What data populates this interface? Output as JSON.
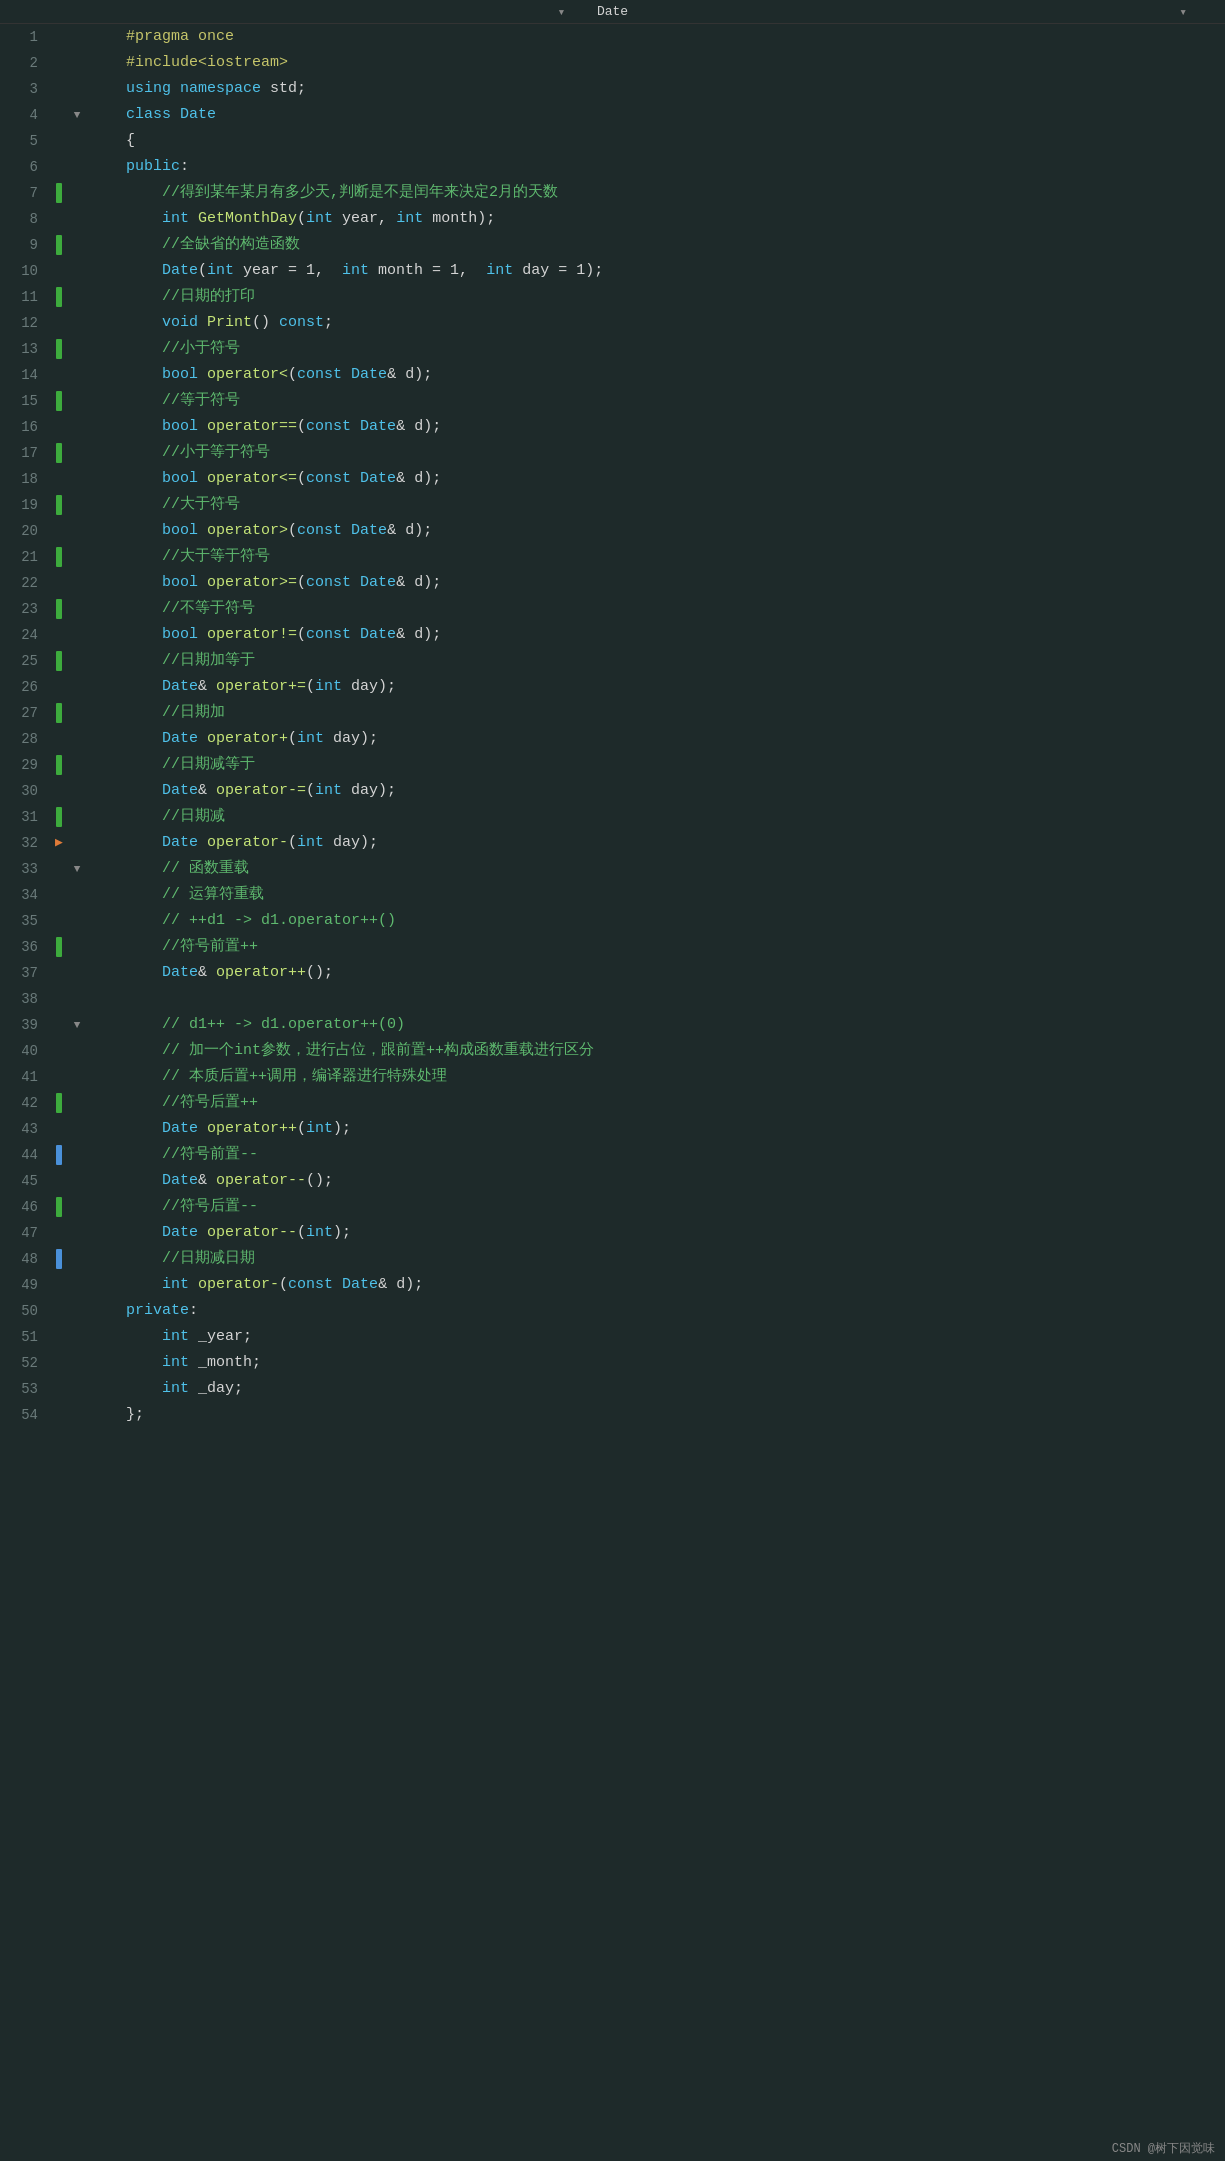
{
  "title": "Date",
  "footer": "CSDN @树下因觉味",
  "lines": [
    {
      "num": 1,
      "gutter": "",
      "fold": "",
      "tokens": [
        {
          "t": "pp",
          "v": "    #pragma once"
        }
      ]
    },
    {
      "num": 2,
      "gutter": "",
      "fold": "",
      "tokens": [
        {
          "t": "pp",
          "v": "    #include<iostream>"
        }
      ]
    },
    {
      "num": 3,
      "gutter": "",
      "fold": "",
      "tokens": [
        {
          "t": "normal",
          "v": "    "
        },
        {
          "t": "kw",
          "v": "using"
        },
        {
          "t": "normal",
          "v": " "
        },
        {
          "t": "kw",
          "v": "namespace"
        },
        {
          "t": "normal",
          "v": " std;"
        }
      ]
    },
    {
      "num": 4,
      "gutter": "",
      "fold": "▼",
      "tokens": [
        {
          "t": "kw",
          "v": "    class"
        },
        {
          "t": "normal",
          "v": " "
        },
        {
          "t": "type",
          "v": "Date"
        }
      ]
    },
    {
      "num": 5,
      "gutter": "",
      "fold": "",
      "tokens": [
        {
          "t": "normal",
          "v": "    {"
        }
      ]
    },
    {
      "num": 6,
      "gutter": "",
      "fold": "",
      "tokens": [
        {
          "t": "kw",
          "v": "    public"
        },
        {
          "t": "normal",
          "v": ":"
        }
      ]
    },
    {
      "num": 7,
      "gutter": "dot",
      "fold": "",
      "tokens": [
        {
          "t": "cm",
          "v": "        //得到某年某月有多少天,判断是不是闰年来决定2月的天数"
        }
      ]
    },
    {
      "num": 8,
      "gutter": "",
      "fold": "",
      "tokens": [
        {
          "t": "normal",
          "v": "        "
        },
        {
          "t": "kw",
          "v": "int"
        },
        {
          "t": "normal",
          "v": " "
        },
        {
          "t": "fn",
          "v": "GetMonthDay"
        },
        {
          "t": "normal",
          "v": "("
        },
        {
          "t": "kw",
          "v": "int"
        },
        {
          "t": "normal",
          "v": " year, "
        },
        {
          "t": "kw",
          "v": "int"
        },
        {
          "t": "normal",
          "v": " month);"
        }
      ]
    },
    {
      "num": 9,
      "gutter": "dot",
      "fold": "",
      "tokens": [
        {
          "t": "cm",
          "v": "        //全缺省的构造函数"
        }
      ]
    },
    {
      "num": 10,
      "gutter": "",
      "fold": "",
      "tokens": [
        {
          "t": "normal",
          "v": "        "
        },
        {
          "t": "type",
          "v": "Date"
        },
        {
          "t": "normal",
          "v": "("
        },
        {
          "t": "kw",
          "v": "int"
        },
        {
          "t": "normal",
          "v": " year = 1,  "
        },
        {
          "t": "kw",
          "v": "int"
        },
        {
          "t": "normal",
          "v": " month = 1,  "
        },
        {
          "t": "kw",
          "v": "int"
        },
        {
          "t": "normal",
          "v": " day = 1);"
        }
      ]
    },
    {
      "num": 11,
      "gutter": "dot",
      "fold": "",
      "tokens": [
        {
          "t": "cm",
          "v": "        //日期的打印"
        }
      ]
    },
    {
      "num": 12,
      "gutter": "",
      "fold": "",
      "tokens": [
        {
          "t": "normal",
          "v": "        "
        },
        {
          "t": "kw",
          "v": "void"
        },
        {
          "t": "normal",
          "v": " "
        },
        {
          "t": "fn",
          "v": "Print"
        },
        {
          "t": "normal",
          "v": "() "
        },
        {
          "t": "kw",
          "v": "const"
        },
        {
          "t": "normal",
          "v": ";"
        }
      ]
    },
    {
      "num": 13,
      "gutter": "dot",
      "fold": "",
      "tokens": [
        {
          "t": "cm",
          "v": "        //小于符号"
        }
      ]
    },
    {
      "num": 14,
      "gutter": "",
      "fold": "",
      "tokens": [
        {
          "t": "normal",
          "v": "        "
        },
        {
          "t": "kw",
          "v": "bool"
        },
        {
          "t": "normal",
          "v": " "
        },
        {
          "t": "fn",
          "v": "operator<"
        },
        {
          "t": "normal",
          "v": "("
        },
        {
          "t": "kw",
          "v": "const"
        },
        {
          "t": "normal",
          "v": " "
        },
        {
          "t": "type",
          "v": "Date"
        },
        {
          "t": "normal",
          "v": "& d);"
        }
      ]
    },
    {
      "num": 15,
      "gutter": "dot",
      "fold": "",
      "tokens": [
        {
          "t": "cm",
          "v": "        //等于符号"
        }
      ]
    },
    {
      "num": 16,
      "gutter": "",
      "fold": "",
      "tokens": [
        {
          "t": "normal",
          "v": "        "
        },
        {
          "t": "kw",
          "v": "bool"
        },
        {
          "t": "normal",
          "v": " "
        },
        {
          "t": "fn",
          "v": "operator=="
        },
        {
          "t": "normal",
          "v": "("
        },
        {
          "t": "kw",
          "v": "const"
        },
        {
          "t": "normal",
          "v": " "
        },
        {
          "t": "type",
          "v": "Date"
        },
        {
          "t": "normal",
          "v": "& d);"
        }
      ]
    },
    {
      "num": 17,
      "gutter": "dot",
      "fold": "",
      "tokens": [
        {
          "t": "cm",
          "v": "        //小于等于符号"
        }
      ]
    },
    {
      "num": 18,
      "gutter": "",
      "fold": "",
      "tokens": [
        {
          "t": "normal",
          "v": "        "
        },
        {
          "t": "kw",
          "v": "bool"
        },
        {
          "t": "normal",
          "v": " "
        },
        {
          "t": "fn",
          "v": "operator<="
        },
        {
          "t": "normal",
          "v": "("
        },
        {
          "t": "kw",
          "v": "const"
        },
        {
          "t": "normal",
          "v": " "
        },
        {
          "t": "type",
          "v": "Date"
        },
        {
          "t": "normal",
          "v": "& d);"
        }
      ]
    },
    {
      "num": 19,
      "gutter": "dot",
      "fold": "",
      "tokens": [
        {
          "t": "cm",
          "v": "        //大于符号"
        }
      ]
    },
    {
      "num": 20,
      "gutter": "",
      "fold": "",
      "tokens": [
        {
          "t": "normal",
          "v": "        "
        },
        {
          "t": "kw",
          "v": "bool"
        },
        {
          "t": "normal",
          "v": " "
        },
        {
          "t": "fn",
          "v": "operator>"
        },
        {
          "t": "normal",
          "v": "("
        },
        {
          "t": "kw",
          "v": "const"
        },
        {
          "t": "normal",
          "v": " "
        },
        {
          "t": "type",
          "v": "Date"
        },
        {
          "t": "normal",
          "v": "& d);"
        }
      ]
    },
    {
      "num": 21,
      "gutter": "dot",
      "fold": "",
      "tokens": [
        {
          "t": "cm",
          "v": "        //大于等于符号"
        }
      ]
    },
    {
      "num": 22,
      "gutter": "",
      "fold": "",
      "tokens": [
        {
          "t": "normal",
          "v": "        "
        },
        {
          "t": "kw",
          "v": "bool"
        },
        {
          "t": "normal",
          "v": " "
        },
        {
          "t": "fn",
          "v": "operator>="
        },
        {
          "t": "normal",
          "v": "("
        },
        {
          "t": "kw",
          "v": "const"
        },
        {
          "t": "normal",
          "v": " "
        },
        {
          "t": "type",
          "v": "Date"
        },
        {
          "t": "normal",
          "v": "& d);"
        }
      ]
    },
    {
      "num": 23,
      "gutter": "dot",
      "fold": "",
      "tokens": [
        {
          "t": "cm",
          "v": "        //不等于符号"
        }
      ]
    },
    {
      "num": 24,
      "gutter": "",
      "fold": "",
      "tokens": [
        {
          "t": "normal",
          "v": "        "
        },
        {
          "t": "kw",
          "v": "bool"
        },
        {
          "t": "normal",
          "v": " "
        },
        {
          "t": "fn",
          "v": "operator!="
        },
        {
          "t": "normal",
          "v": "("
        },
        {
          "t": "kw",
          "v": "const"
        },
        {
          "t": "normal",
          "v": " "
        },
        {
          "t": "type",
          "v": "Date"
        },
        {
          "t": "normal",
          "v": "& d);"
        }
      ]
    },
    {
      "num": 25,
      "gutter": "dot",
      "fold": "",
      "tokens": [
        {
          "t": "cm",
          "v": "        //日期加等于"
        }
      ]
    },
    {
      "num": 26,
      "gutter": "",
      "fold": "",
      "tokens": [
        {
          "t": "normal",
          "v": "        "
        },
        {
          "t": "type",
          "v": "Date"
        },
        {
          "t": "normal",
          "v": "& "
        },
        {
          "t": "fn",
          "v": "operator+="
        },
        {
          "t": "normal",
          "v": "("
        },
        {
          "t": "kw",
          "v": "int"
        },
        {
          "t": "normal",
          "v": " day);"
        }
      ]
    },
    {
      "num": 27,
      "gutter": "dot",
      "fold": "",
      "tokens": [
        {
          "t": "cm",
          "v": "        //日期加"
        }
      ]
    },
    {
      "num": 28,
      "gutter": "",
      "fold": "",
      "tokens": [
        {
          "t": "normal",
          "v": "        "
        },
        {
          "t": "type",
          "v": "Date"
        },
        {
          "t": "normal",
          "v": " "
        },
        {
          "t": "fn",
          "v": "operator+"
        },
        {
          "t": "normal",
          "v": "("
        },
        {
          "t": "kw",
          "v": "int"
        },
        {
          "t": "normal",
          "v": " day);"
        }
      ]
    },
    {
      "num": 29,
      "gutter": "dot",
      "fold": "",
      "tokens": [
        {
          "t": "cm",
          "v": "        //日期减等于"
        }
      ]
    },
    {
      "num": 30,
      "gutter": "",
      "fold": "",
      "tokens": [
        {
          "t": "normal",
          "v": "        "
        },
        {
          "t": "type",
          "v": "Date"
        },
        {
          "t": "normal",
          "v": "& "
        },
        {
          "t": "fn",
          "v": "operator-="
        },
        {
          "t": "normal",
          "v": "("
        },
        {
          "t": "kw",
          "v": "int"
        },
        {
          "t": "normal",
          "v": " day);"
        }
      ]
    },
    {
      "num": 31,
      "gutter": "dot",
      "fold": "",
      "tokens": [
        {
          "t": "cm",
          "v": "        //日期减"
        }
      ]
    },
    {
      "num": 32,
      "gutter": "arrow",
      "fold": "",
      "tokens": [
        {
          "t": "normal",
          "v": "        "
        },
        {
          "t": "type",
          "v": "Date"
        },
        {
          "t": "normal",
          "v": " "
        },
        {
          "t": "fn",
          "v": "operator-"
        },
        {
          "t": "normal",
          "v": "("
        },
        {
          "t": "kw",
          "v": "int"
        },
        {
          "t": "normal",
          "v": " day);"
        }
      ]
    },
    {
      "num": 33,
      "gutter": "",
      "fold": "▼",
      "tokens": [
        {
          "t": "cm",
          "v": "        // 函数重载"
        }
      ]
    },
    {
      "num": 34,
      "gutter": "",
      "fold": "",
      "tokens": [
        {
          "t": "cm",
          "v": "        // 运算符重载"
        }
      ]
    },
    {
      "num": 35,
      "gutter": "",
      "fold": "",
      "tokens": [
        {
          "t": "cm",
          "v": "        // ++d1 -> d1.operator++()"
        }
      ]
    },
    {
      "num": 36,
      "gutter": "dot",
      "fold": "",
      "tokens": [
        {
          "t": "cm",
          "v": "        //符号前置++"
        }
      ]
    },
    {
      "num": 37,
      "gutter": "",
      "fold": "",
      "tokens": [
        {
          "t": "normal",
          "v": "        "
        },
        {
          "t": "type",
          "v": "Date"
        },
        {
          "t": "normal",
          "v": "& "
        },
        {
          "t": "fn",
          "v": "operator++"
        },
        {
          "t": "normal",
          "v": "();"
        }
      ]
    },
    {
      "num": 38,
      "gutter": "",
      "fold": "",
      "tokens": [
        {
          "t": "normal",
          "v": ""
        }
      ]
    },
    {
      "num": 39,
      "gutter": "",
      "fold": "▼",
      "tokens": [
        {
          "t": "cm",
          "v": "        // d1++ -> d1.operator++(0)"
        }
      ]
    },
    {
      "num": 40,
      "gutter": "",
      "fold": "",
      "tokens": [
        {
          "t": "cm",
          "v": "        // 加一个int参数，进行占位，跟前置++构成函数重载进行区分"
        }
      ]
    },
    {
      "num": 41,
      "gutter": "",
      "fold": "",
      "tokens": [
        {
          "t": "cm",
          "v": "        // 本质后置++调用，编译器进行特殊处理"
        }
      ]
    },
    {
      "num": 42,
      "gutter": "dot",
      "fold": "",
      "tokens": [
        {
          "t": "cm",
          "v": "        //符号后置++"
        }
      ]
    },
    {
      "num": 43,
      "gutter": "",
      "fold": "",
      "tokens": [
        {
          "t": "normal",
          "v": "        "
        },
        {
          "t": "type",
          "v": "Date"
        },
        {
          "t": "normal",
          "v": " "
        },
        {
          "t": "fn",
          "v": "operator++"
        },
        {
          "t": "normal",
          "v": "("
        },
        {
          "t": "kw",
          "v": "int"
        },
        {
          "t": "normal",
          "v": ");"
        }
      ]
    },
    {
      "num": 44,
      "gutter": "dotblue",
      "fold": "",
      "tokens": [
        {
          "t": "cm",
          "v": "        //符号前置--"
        }
      ]
    },
    {
      "num": 45,
      "gutter": "",
      "fold": "",
      "tokens": [
        {
          "t": "normal",
          "v": "        "
        },
        {
          "t": "type",
          "v": "Date"
        },
        {
          "t": "normal",
          "v": "& "
        },
        {
          "t": "fn",
          "v": "operator--"
        },
        {
          "t": "normal",
          "v": "();"
        }
      ]
    },
    {
      "num": 46,
      "gutter": "dot",
      "fold": "",
      "tokens": [
        {
          "t": "cm",
          "v": "        //符号后置--"
        }
      ]
    },
    {
      "num": 47,
      "gutter": "",
      "fold": "",
      "tokens": [
        {
          "t": "normal",
          "v": "        "
        },
        {
          "t": "type",
          "v": "Date"
        },
        {
          "t": "normal",
          "v": " "
        },
        {
          "t": "fn",
          "v": "operator--"
        },
        {
          "t": "normal",
          "v": "("
        },
        {
          "t": "kw",
          "v": "int"
        },
        {
          "t": "normal",
          "v": ");"
        }
      ]
    },
    {
      "num": 48,
      "gutter": "dotblue",
      "fold": "",
      "tokens": [
        {
          "t": "cm",
          "v": "        //日期减日期"
        }
      ]
    },
    {
      "num": 49,
      "gutter": "",
      "fold": "",
      "tokens": [
        {
          "t": "normal",
          "v": "        "
        },
        {
          "t": "kw",
          "v": "int"
        },
        {
          "t": "normal",
          "v": " "
        },
        {
          "t": "fn",
          "v": "operator-"
        },
        {
          "t": "normal",
          "v": "("
        },
        {
          "t": "kw",
          "v": "const"
        },
        {
          "t": "normal",
          "v": " "
        },
        {
          "t": "type",
          "v": "Date"
        },
        {
          "t": "normal",
          "v": "& d);"
        }
      ]
    },
    {
      "num": 50,
      "gutter": "",
      "fold": "",
      "tokens": [
        {
          "t": "kw",
          "v": "    private"
        },
        {
          "t": "normal",
          "v": ":"
        }
      ]
    },
    {
      "num": 51,
      "gutter": "",
      "fold": "",
      "tokens": [
        {
          "t": "normal",
          "v": "        "
        },
        {
          "t": "kw",
          "v": "int"
        },
        {
          "t": "normal",
          "v": " _year;"
        }
      ]
    },
    {
      "num": 52,
      "gutter": "",
      "fold": "",
      "tokens": [
        {
          "t": "normal",
          "v": "        "
        },
        {
          "t": "kw",
          "v": "int"
        },
        {
          "t": "normal",
          "v": " _month;"
        }
      ]
    },
    {
      "num": 53,
      "gutter": "",
      "fold": "",
      "tokens": [
        {
          "t": "normal",
          "v": "        "
        },
        {
          "t": "kw",
          "v": "int"
        },
        {
          "t": "normal",
          "v": " _day;"
        }
      ]
    },
    {
      "num": 54,
      "gutter": "",
      "fold": "",
      "tokens": [
        {
          "t": "normal",
          "v": "    };"
        }
      ]
    }
  ]
}
